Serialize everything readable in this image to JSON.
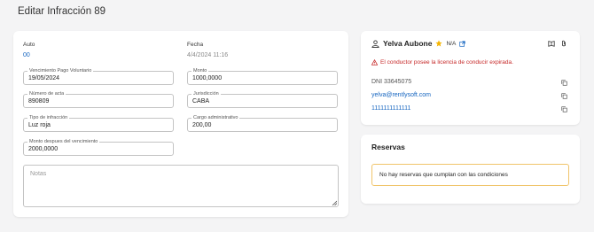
{
  "page": {
    "title": "Editar Infracción 89"
  },
  "vehicle": {
    "label": "Auto",
    "value": "00"
  },
  "fecha": {
    "label": "Fecha",
    "value": "4/4/2024 11:16"
  },
  "fields": {
    "vencimiento": {
      "label": "Vencimiento Pago Voluntario",
      "value": "19/05/2024"
    },
    "monto": {
      "label": "Monto",
      "value": "1000,0000"
    },
    "numero_acta": {
      "label": "Número de acta",
      "value": "890809"
    },
    "jurisdiccion": {
      "label": "Jurisdicción",
      "value": "CABA"
    },
    "tipo_infraccion": {
      "label": "Tipo de infracción",
      "value": "Luz roja"
    },
    "cargo_admin": {
      "label": "Cargo administrativo",
      "value": "200,00"
    },
    "monto_despues": {
      "label": "Monto despues del vencimiento",
      "value": "2000,0000"
    }
  },
  "notas": {
    "placeholder": "Notas"
  },
  "driver": {
    "name": "Yelva Aubone",
    "rating": "N/A",
    "alert": "El conductor posee la licencia de conducir expirada.",
    "dni": "DNI 33645075",
    "email": "yelva@rentlysoft.com",
    "phone": "1111111111111"
  },
  "reservas": {
    "title": "Reservas",
    "empty_message": "No hay reservas que cumplan con las condiciones"
  },
  "colors": {
    "link": "#1565c0",
    "alert": "#c62828",
    "star": "#f5b400",
    "warning_border": "#f0c46a"
  }
}
